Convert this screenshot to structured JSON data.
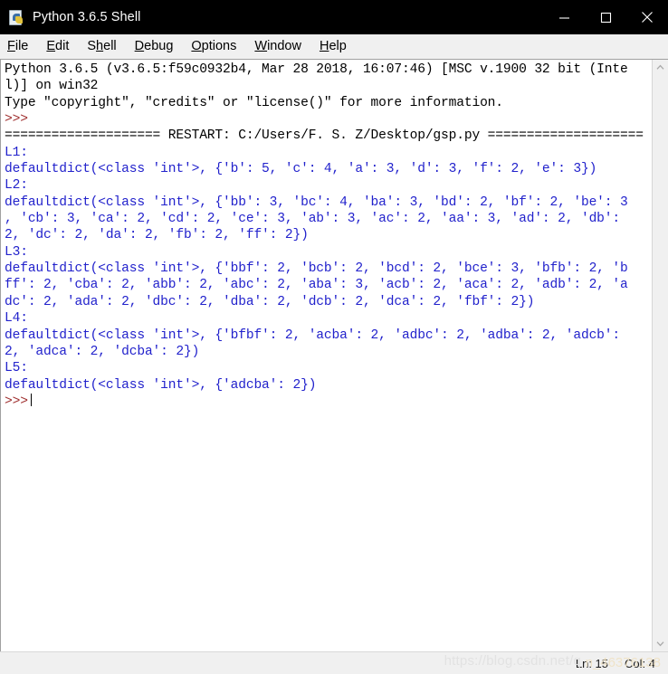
{
  "window": {
    "title": "Python 3.6.5 Shell",
    "icon": "python-file-icon",
    "controls": {
      "minimize": "minimize-icon",
      "maximize": "maximize-icon",
      "close": "close-icon"
    }
  },
  "menubar": {
    "items": [
      {
        "label": "File",
        "accel": "F"
      },
      {
        "label": "Edit",
        "accel": "E"
      },
      {
        "label": "Shell",
        "accel": "h"
      },
      {
        "label": "Debug",
        "accel": "D"
      },
      {
        "label": "Options",
        "accel": "O"
      },
      {
        "label": "Window",
        "accel": "W"
      },
      {
        "label": "Help",
        "accel": "H"
      }
    ]
  },
  "shell": {
    "banner_line_1": "Python 3.6.5 (v3.6.5:f59c0932b4, Mar 28 2018, 16:07:46) [MSC v.1900 32 bit (Inte",
    "banner_line_2": "l)] on win32",
    "banner_line_3": "Type \"copyright\", \"credits\" or \"license()\" for more information.",
    "prompt": ">>>",
    "restart_line": "==================== RESTART: C:/Users/F. S. Z/Desktop/gsp.py ====================",
    "blocks": [
      {
        "label": "L1:",
        "lines": [
          "defaultdict(<class 'int'>, {'b': 5, 'c': 4, 'a': 3, 'd': 3, 'f': 2, 'e': 3})"
        ]
      },
      {
        "label": "L2:",
        "lines": [
          "defaultdict(<class 'int'>, {'bb': 3, 'bc': 4, 'ba': 3, 'bd': 2, 'bf': 2, 'be': 3",
          ", 'cb': 3, 'ca': 2, 'cd': 2, 'ce': 3, 'ab': 3, 'ac': 2, 'aa': 3, 'ad': 2, 'db':",
          "2, 'dc': 2, 'da': 2, 'fb': 2, 'ff': 2})"
        ]
      },
      {
        "label": "L3:",
        "lines": [
          "defaultdict(<class 'int'>, {'bbf': 2, 'bcb': 2, 'bcd': 2, 'bce': 3, 'bfb': 2, 'b",
          "ff': 2, 'cba': 2, 'abb': 2, 'abc': 2, 'aba': 3, 'acb': 2, 'aca': 2, 'adb': 2, 'a",
          "dc': 2, 'ada': 2, 'dbc': 2, 'dba': 2, 'dcb': 2, 'dca': 2, 'fbf': 2})"
        ]
      },
      {
        "label": "L4:",
        "lines": [
          "defaultdict(<class 'int'>, {'bfbf': 2, 'acba': 2, 'adbc': 2, 'adba': 2, 'adcb':",
          "2, 'adca': 2, 'dcba': 2})"
        ]
      },
      {
        "label": "L5:",
        "lines": [
          "defaultdict(<class 'int'>, {'adcba': 2})"
        ]
      }
    ],
    "final_prompt": ">>>"
  },
  "statusbar": {
    "line": "Ln: 15",
    "col": "Col: 4",
    "watermark": "https://blog.csdn.net/q",
    "watermark_tail": "n_46376138"
  },
  "colors": {
    "titlebar_bg": "#000000",
    "titlebar_fg": "#ffffff",
    "output_blue": "#2222cc",
    "prompt_red": "#a03030",
    "stdout_black": "#000000",
    "chrome_bg": "#f0f0f0",
    "text_bg": "#ffffff"
  }
}
